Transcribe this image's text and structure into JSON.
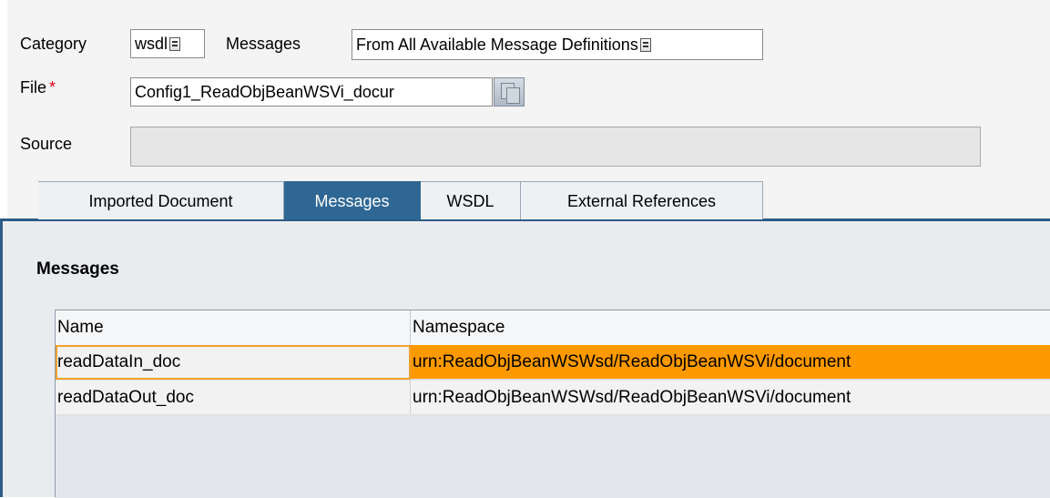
{
  "form": {
    "category_label": "Category",
    "category_value": "wsdl",
    "messages_label": "Messages",
    "messages_value": "From All Available Message Definitions",
    "file_label": "File",
    "file_required_marker": "*",
    "file_value": "Config1_ReadObjBeanWSVi_docur",
    "source_label": "Source",
    "source_value": ""
  },
  "tabs": [
    {
      "label": "Imported Document",
      "active": false
    },
    {
      "label": "Messages",
      "active": true
    },
    {
      "label": "WSDL",
      "active": false
    },
    {
      "label": "External References",
      "active": false
    }
  ],
  "messages_section": {
    "title": "Messages",
    "columns": [
      "Name",
      "Namespace"
    ],
    "rows": [
      {
        "name": "readDataIn_doc",
        "namespace": "urn:ReadObjBeanWSWsd/ReadObjBeanWSVi/document",
        "selected": true
      },
      {
        "name": "readDataOut_doc",
        "namespace": "urn:ReadObjBeanWSWsd/ReadObjBeanWSVi/document",
        "selected": false
      }
    ]
  },
  "icons": {
    "dropdown": "dropdown-icon",
    "copy": "copy-document-icon"
  },
  "colors": {
    "active_tab": "#2f6794",
    "selection": "#ff9900",
    "required": "#e0001a"
  }
}
